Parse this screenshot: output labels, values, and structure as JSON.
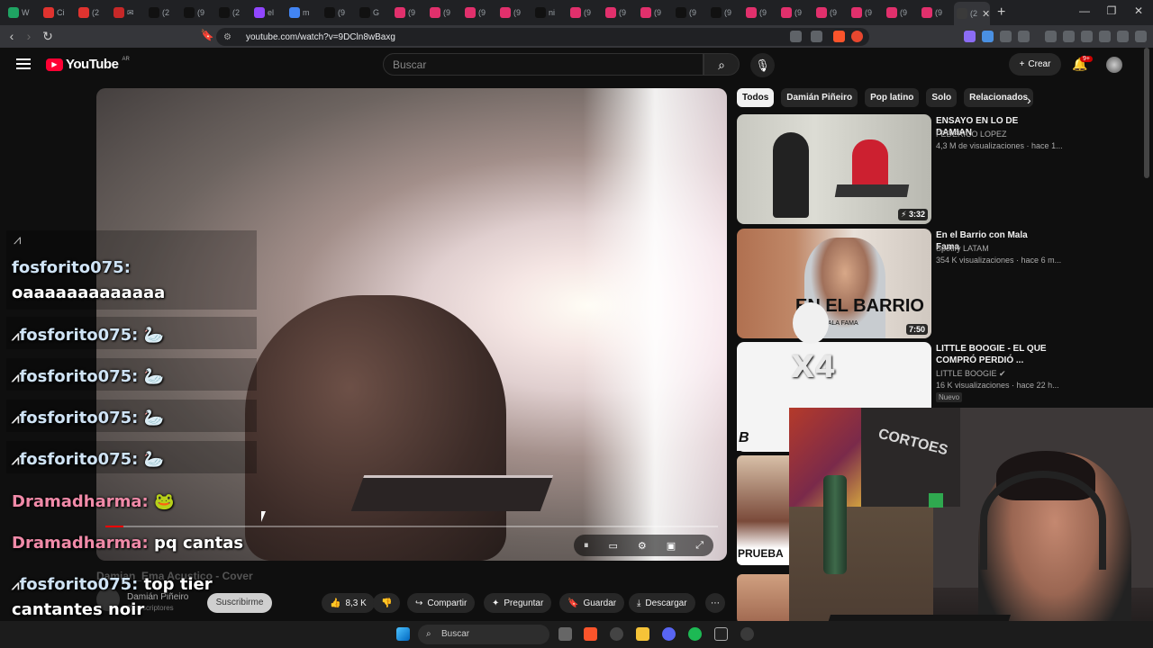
{
  "browser": {
    "tabs": [
      {
        "label": "W",
        "color": "#1fa463",
        "close": "✕"
      },
      {
        "label": "Ci",
        "color": "#e0332f",
        "close": "✕"
      },
      {
        "label": "(2",
        "color": "#e0332f",
        "close": "✕"
      },
      {
        "label": "✉",
        "color": "#c62828",
        "close": "✕"
      },
      {
        "label": "(2",
        "color": "#111111",
        "close": "✕"
      },
      {
        "label": "(9",
        "color": "#111111",
        "close": "✕"
      },
      {
        "label": "(2",
        "color": "#111111",
        "close": "✕"
      },
      {
        "label": "el",
        "color": "#9146ff",
        "close": "✕"
      },
      {
        "label": "m",
        "color": "#4285f4",
        "close": "✕"
      },
      {
        "label": "(9",
        "color": "#111111",
        "close": "✕"
      },
      {
        "label": "G",
        "color": "#111111",
        "close": "✕"
      },
      {
        "label": "(9",
        "color": "#e1306c",
        "close": "✕"
      },
      {
        "label": "(9",
        "color": "#e1306c",
        "close": "✕"
      },
      {
        "label": "(9",
        "color": "#e1306c",
        "close": "✕"
      },
      {
        "label": "(9",
        "color": "#e1306c",
        "close": "✕"
      },
      {
        "label": "ni",
        "color": "#111111",
        "close": "✕"
      },
      {
        "label": "(9",
        "color": "#e1306c",
        "close": "✕"
      },
      {
        "label": "(9",
        "color": "#e1306c",
        "close": "✕"
      },
      {
        "label": "(9",
        "color": "#e1306c",
        "close": "✕"
      },
      {
        "label": "(9",
        "color": "#111111",
        "close": "✕"
      },
      {
        "label": "(9",
        "color": "#111111",
        "close": "✕"
      },
      {
        "label": "(9",
        "color": "#e1306c",
        "close": "✕"
      },
      {
        "label": "(9",
        "color": "#e1306c",
        "close": "✕"
      },
      {
        "label": "(9",
        "color": "#e1306c",
        "close": "✕"
      },
      {
        "label": "(9",
        "color": "#e1306c",
        "close": "✕"
      },
      {
        "label": "(9",
        "color": "#e1306c",
        "close": "✕"
      },
      {
        "label": "(9",
        "color": "#e1306c",
        "close": "✕"
      },
      {
        "label": "(2",
        "color": "#3a3a3a",
        "close": "✕",
        "active": true
      }
    ],
    "new_tab": "+",
    "window_minimize": "—",
    "window_restore": "❐",
    "window_close": "✕",
    "url": "youtube.com/watch?v=9DCln8wBaxg"
  },
  "header": {
    "logo_text": "YouTube",
    "country_code": "AR",
    "search_placeholder": "Buscar",
    "create_label": "Crear",
    "notifications_count": "9+"
  },
  "chips": [
    "Todos",
    "Damián Piñeiro",
    "Pop latino",
    "Solo",
    "Relacionados"
  ],
  "recommendations": [
    {
      "title": "ENSAYO EN LO DE DAMIAN",
      "channel": "FEDERICO LOPEZ",
      "views": "4,3 M de visualizaciones · hace 1...",
      "duration": "3:32",
      "short_icon": true
    },
    {
      "title": "En el Barrio con Mala Fama",
      "channel": "Spotify LATAM",
      "views": "354 K visualizaciones · hace 6 m...",
      "duration": "7:50",
      "thumb_text": "EN EL BARRIO",
      "thumb_sub": "MALA FAMA"
    },
    {
      "title": "LITTLE BOOGIE - EL QUE COMPRÓ PERDIÓ ...",
      "channel": "LITTLE BOOGIE",
      "verified": true,
      "views": "16 K visualizaciones · hace 22 h...",
      "badge": "Nuevo"
    }
  ],
  "side_thumbs": [
    {
      "label": "B"
    },
    {
      "label": "PRUEBA"
    }
  ],
  "chat": [
    {
      "user": "fosforito075:",
      "text": "oaaaaaaaaaaaaa",
      "user_style": "user"
    },
    {
      "user": "fosforito075:",
      "text": "🦢",
      "user_style": "user"
    },
    {
      "user": "fosforito075:",
      "text": "🦢",
      "user_style": "user"
    },
    {
      "user": "fosforito075:",
      "text": "🦢",
      "user_style": "user"
    },
    {
      "user": "fosforito075:",
      "text": "🦢",
      "user_style": "user"
    },
    {
      "user": "Dramadharma:",
      "text": "🐸",
      "user_style": "user2"
    },
    {
      "user": "Dramadharma:",
      "text": "pq cantas",
      "user_style": "user2"
    },
    {
      "user": "fosforito075:",
      "text": "top tier cantantes noir",
      "user_style": "user"
    }
  ],
  "video": {
    "title": "Damian_Ema Acustico - Cover",
    "channel": "Damián Piñeiro",
    "subscribers": "K suscriptores",
    "subscribe_label": "Suscribirme",
    "likes": "8,3 K",
    "share_label": "Compartir",
    "ask_label": "Preguntar",
    "save_label": "Guardar",
    "download_label": "Descargar",
    "progress": 0.03
  },
  "overlay": {
    "multiplier": "X4",
    "webcam_poster_text": "CORTOES"
  },
  "taskbar": {
    "search_placeholder": "Buscar"
  }
}
